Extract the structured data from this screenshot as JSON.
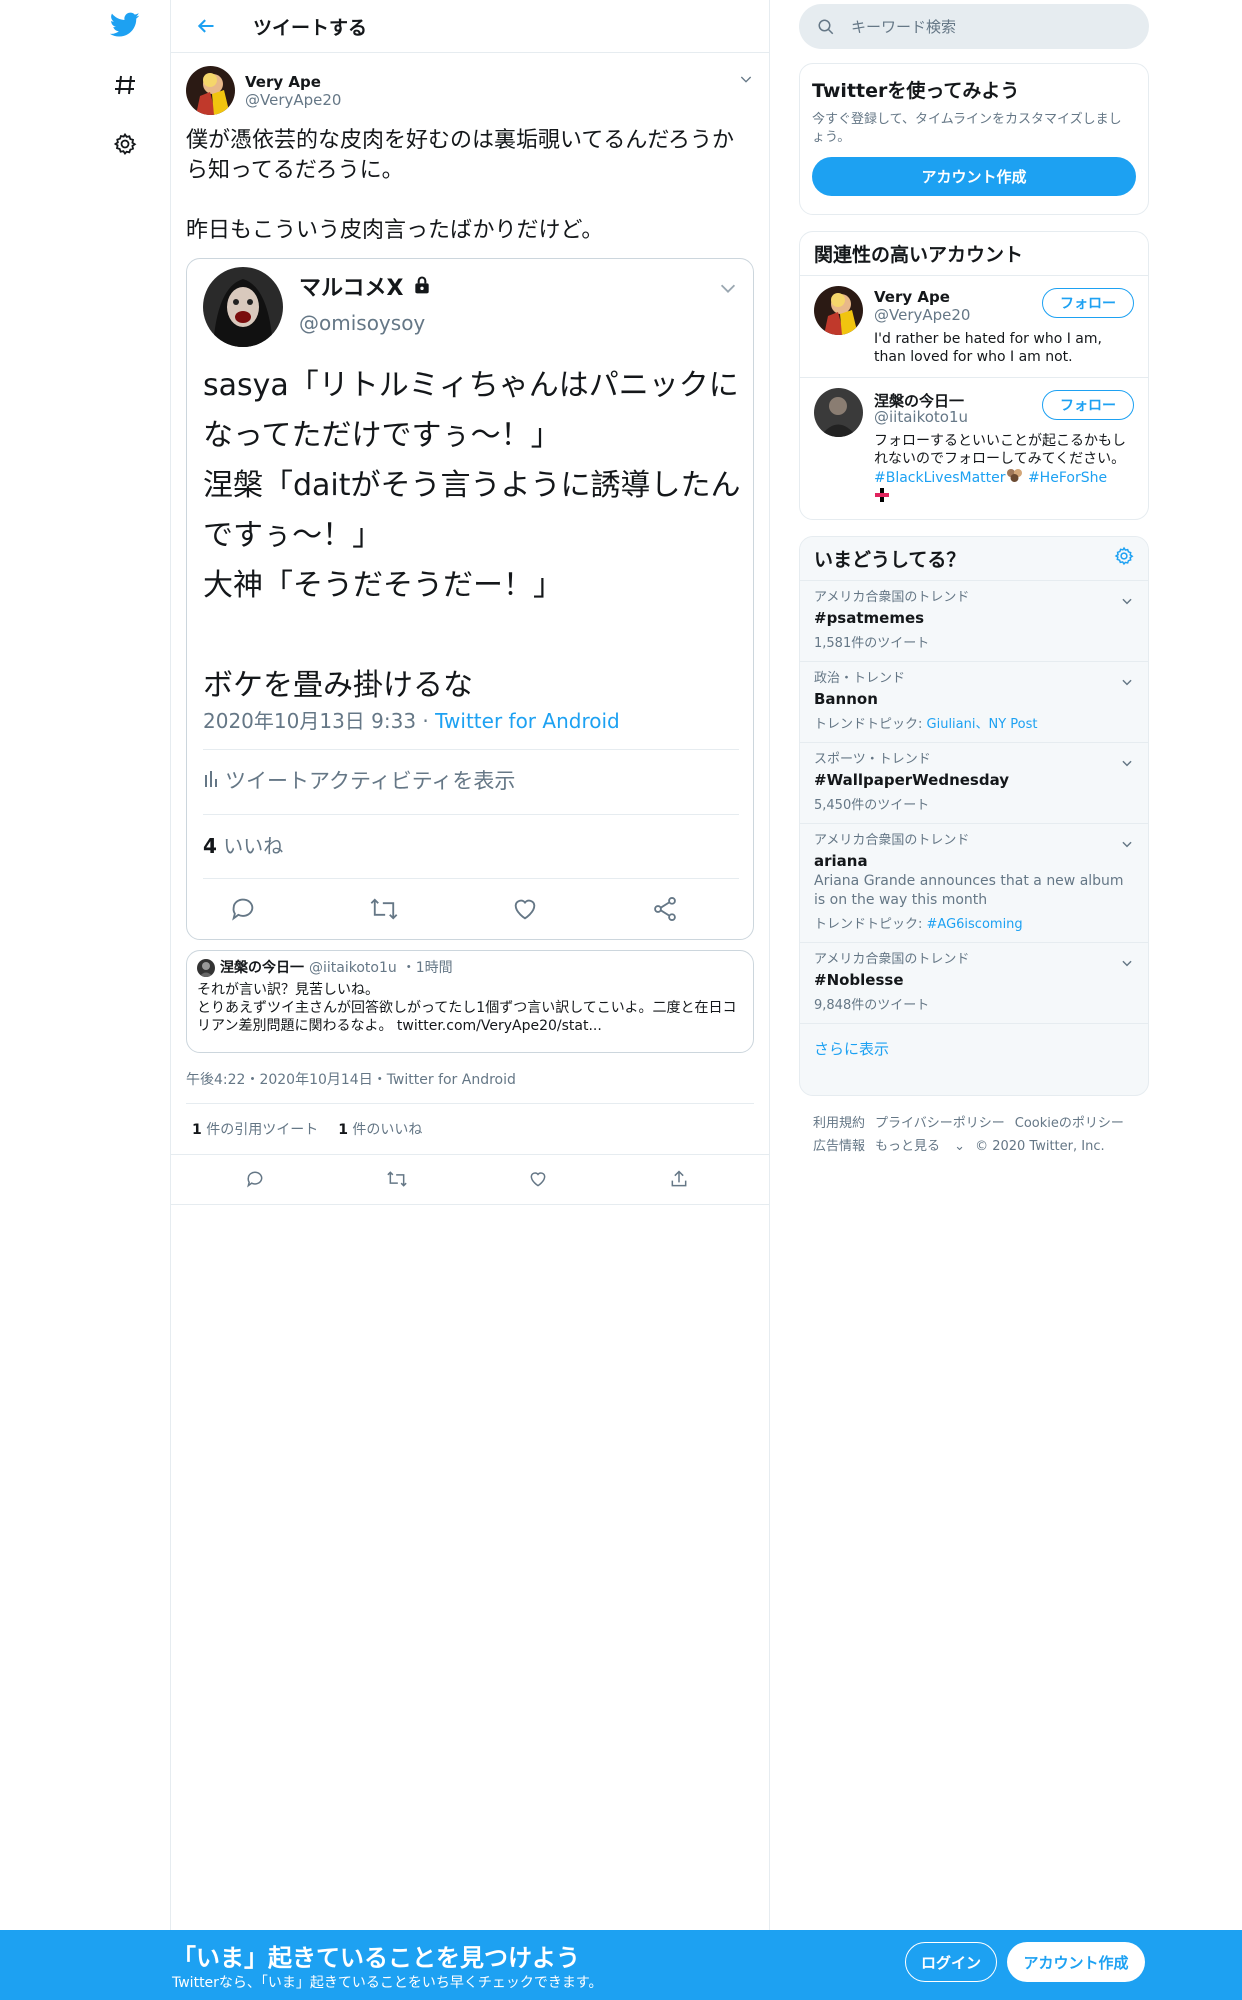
{
  "header": {
    "title": "ツイートする"
  },
  "tweet": {
    "author_name": "Very Ape",
    "author_handle": "@VeryApe20",
    "text": "僕が憑依芸的な皮肉を好むのは裏垢覗いてるんだろうから知ってるだろうに。\n\n昨日もこういう皮肉言ったばかりだけど。",
    "meta": "午後4:22・2020年10月14日・Twitter for Android",
    "quote_tweets_count": "1",
    "quote_tweets_label": "件の引用ツイート",
    "likes_count": "1",
    "likes_label": "件のいいね"
  },
  "embedded_image": {
    "name": "マルコメX",
    "handle": "@omisoysoy",
    "text": "sasya「リトルミィちゃんはパニックになってただけですぅ～！」\n涅槃「daitがそう言うように誘導したんですぅ～！」\n大神「そうだそうだー！」\n\nボケを畳み掛けるな",
    "date": "2020年10月13日 9:33 · ",
    "via": "Twitter for Android",
    "activity_label": "ツイートアクティビティを表示",
    "likes_count": "4",
    "likes_label": "いいね"
  },
  "quoted": {
    "name": "涅槃の今日一",
    "handle": "@iitaikoto1u",
    "time": "・1時間",
    "text": "それが言い訳？見苦しいね。\nとりあえずツイ主さんが回答欲しがってたし1個ずつ言い訳してこいよ。二度と在日コリアン差別問題に関わるなよ。",
    "link": "twitter.com/VeryApe20/stat..."
  },
  "search": {
    "placeholder": "キーワード検索"
  },
  "signup_box": {
    "title": "Twitterを使ってみよう",
    "desc": "今すぐ登録して、タイムラインをカスタマイズしましょう。",
    "button": "アカウント作成"
  },
  "related": {
    "title": "関連性の高いアカウント",
    "follow_label": "フォロー",
    "accounts": [
      {
        "name": "Very Ape",
        "handle": "@VeryApe20",
        "bio": "I'd rather be hated for who I am, than loved for who I am not."
      },
      {
        "name": "涅槃の今日一",
        "handle": "@iitaikoto1u",
        "bio": "フォローするといいことが起こるかもしれないのでフォローしてみてください。",
        "tag1": "#BlackLivesMatter",
        "tag2": "#HeForShe"
      }
    ]
  },
  "trends": {
    "title": "いまどうしてる？",
    "items": [
      {
        "context": "アメリカ合衆国のトレンド",
        "name": "#psatmemes",
        "sub": "1,581件のツイート"
      },
      {
        "context": "政治・トレンド",
        "name": "Bannon",
        "sub_label": "トレンドトピック: ",
        "sub_links": "Giuliani、NY Post"
      },
      {
        "context": "スポーツ・トレンド",
        "name": "#WallpaperWednesday",
        "sub": "5,450件のツイート"
      },
      {
        "context": "アメリカ合衆国のトレンド",
        "name": "ariana",
        "desc": "Ariana Grande announces that a new album is on the way this month",
        "sub_label": "トレンドトピック: ",
        "sub_links": "#AG6iscoming"
      },
      {
        "context": "アメリカ合衆国のトレンド",
        "name": "#Noblesse",
        "sub": "9,848件のツイート"
      }
    ],
    "more": "さらに表示"
  },
  "footer": {
    "terms": "利用規約",
    "privacy": "プライバシーポリシー",
    "cookie": "Cookieのポリシー",
    "ads": "広告情報",
    "more": "もっと見る",
    "copyright": "© 2020 Twitter, Inc."
  },
  "banner": {
    "title": "「いま」起きていることを見つけよう",
    "subtitle": "Twitterなら、「いま」起きていることをいち早くチェックできます。",
    "login": "ログイン",
    "signup": "アカウント作成"
  },
  "colors": {
    "accent": "#1da1f2",
    "text": "#14171a",
    "muted": "#657786",
    "border": "#e6ecf0"
  }
}
